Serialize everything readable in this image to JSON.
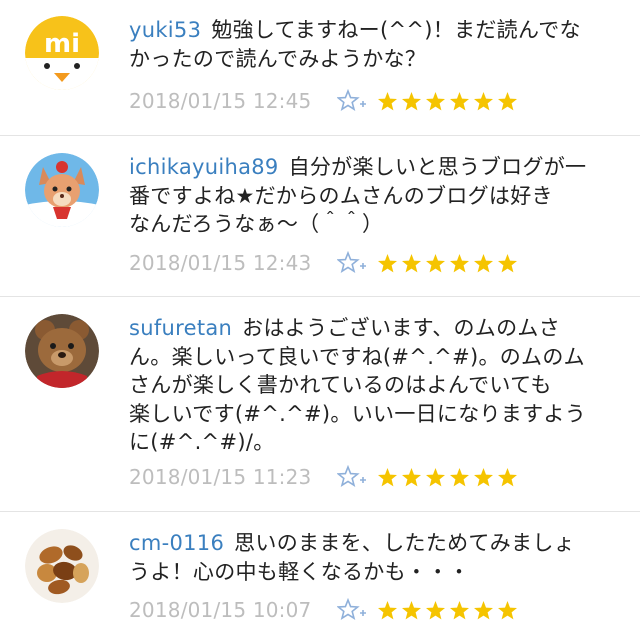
{
  "comments": [
    {
      "user": "yuki53",
      "text": "勉強してますねー(^^)！まだ読んでな\nかったので読んでみようかな？",
      "date": "2018/01/15 12:45",
      "avatar": "mi-logo-avatar",
      "stars": 6
    },
    {
      "user": "ichikayuiha89",
      "text": "自分が楽しいと思うブログが一\n番ですよね★だからのムさんのブログは好き\nなんだろうなぁ〜（＾＾）",
      "date": "2018/01/15 12:43",
      "avatar": "fox-character-avatar",
      "stars": 6
    },
    {
      "user": "sufuretan",
      "text": "おはようございます、のムのムさ\nん。楽しいって良いですね(#^.^#)。のムのム\nさんが楽しく書かれているのはよんでいても\n楽しいです(#^.^#)。いい一日になりますよう\nに(#^.^#)/。",
      "date": "2018/01/15 11:23",
      "avatar": "teddy-bear-avatar",
      "stars": 6
    },
    {
      "user": "cm-0116",
      "text": "思いのままを、したためてみましょ\nうよ！心の中も軽くなるかも・・・",
      "date": "2018/01/15 10:07",
      "avatar": "mixed-nuts-avatar",
      "stars": 6
    }
  ],
  "colors": {
    "username": "#3a7fbf",
    "date": "#bdbdbd",
    "star": "#f5c400",
    "favorite_icon": "#8fb0da"
  }
}
